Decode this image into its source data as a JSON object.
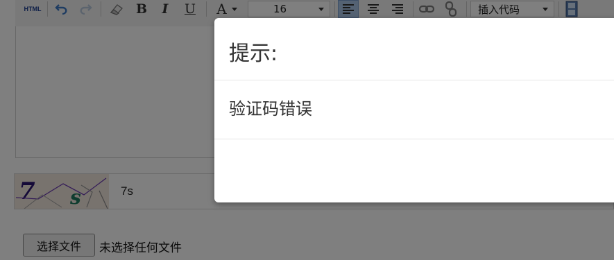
{
  "toolbar": {
    "html_label": "HTML",
    "bold_label": "B",
    "italic_label": "I",
    "underline_label": "U",
    "font_color_label": "A",
    "font_size_value": "16",
    "insert_code_value": "插入代码",
    "active_color": "#a8c4e6"
  },
  "captcha": {
    "input_value": "7s"
  },
  "file_input": {
    "button_label": "选择文件",
    "status_text": "未选择任何文件"
  },
  "modal": {
    "title": "提示:",
    "message": "验证码错误"
  },
  "colors": {
    "overlay": "rgba(0,0,0,0.5)",
    "modal_background": "#ffffff"
  }
}
